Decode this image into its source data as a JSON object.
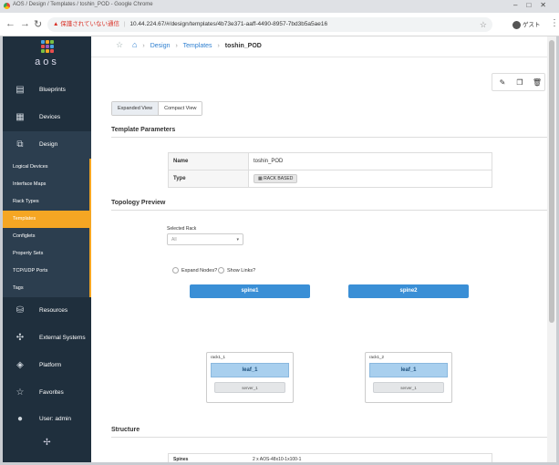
{
  "browser": {
    "window_title": "AOS / Design / Templates / toshin_POD - Google Chrome",
    "security_warning": "保護されていない通信",
    "url": "10.44.224.67/#/design/templates/4b73e371-aaff-4490-8957-7bd3b5a5ae16",
    "profile_label": "ゲスト"
  },
  "sidebar": {
    "logo_text": "aos",
    "items_top": [
      {
        "label": "Blueprints",
        "icon": "blueprints-icon"
      },
      {
        "label": "Devices",
        "icon": "devices-icon"
      },
      {
        "label": "Design",
        "icon": "design-icon"
      }
    ],
    "design_subitems": [
      {
        "label": "Logical Devices"
      },
      {
        "label": "Interface Maps"
      },
      {
        "label": "Rack Types"
      },
      {
        "label": "Templates"
      },
      {
        "label": "Configlets"
      },
      {
        "label": "Property Sets"
      },
      {
        "label": "TCP/UDP Ports"
      },
      {
        "label": "Tags"
      }
    ],
    "active_subitem": "Templates",
    "items_bottom": [
      {
        "label": "Resources",
        "icon": "resources-icon"
      },
      {
        "label": "External Systems",
        "icon": "external-systems-icon"
      },
      {
        "label": "Platform",
        "icon": "platform-icon"
      },
      {
        "label": "Favorites",
        "icon": "star-icon"
      },
      {
        "label": "User: admin",
        "icon": "user-icon"
      }
    ]
  },
  "breadcrumb": {
    "design": "Design",
    "templates": "Templates",
    "current": "toshin_POD"
  },
  "view_toggle": {
    "expanded": "Expanded View",
    "compact": "Compact View",
    "selected": "Expanded View"
  },
  "template_parameters": {
    "section_title": "Template Parameters",
    "rows": [
      {
        "key": "Name",
        "value": "toshin_POD"
      },
      {
        "key": "Type",
        "value": "RACK BASED"
      }
    ]
  },
  "topology_preview": {
    "section_title": "Topology Preview",
    "selected_rack_label": "Selected Rack",
    "selected_rack_value": "All",
    "expand_nodes_label": "Expand Nodes?",
    "show_links_label": "Show Links?",
    "spines": [
      "spine1",
      "spine2"
    ],
    "racks": [
      {
        "label": "rack1_1",
        "leaf": "leaf_1",
        "server": "server_1"
      },
      {
        "label": "rack1_2",
        "leaf": "leaf_1",
        "server": "server_1"
      }
    ]
  },
  "structure": {
    "section_title": "Structure",
    "first_row_key": "Spines",
    "first_row_value": "2 x AOS-48x10-1x100-1"
  }
}
